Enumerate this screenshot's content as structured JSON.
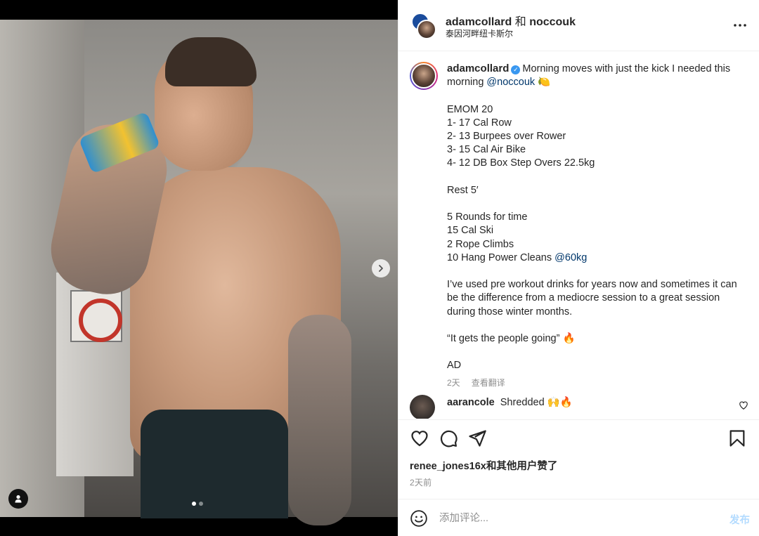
{
  "header": {
    "user1": "adamcollard",
    "and": "和",
    "user2": "noccouk",
    "location": "泰因河畔纽卡斯尔"
  },
  "caption": {
    "username": "adamcollard",
    "text_intro": "Morning moves with just the kick I needed this morning",
    "mention": "@noccouk",
    "emoji": "🍋",
    "lines": [
      "EMOM 20",
      "1- 17 Cal Row",
      "2- 13 Burpees over Rower",
      "3- 15 Cal Air Bike",
      "4- 12 DB Box Step Overs 22.5kg",
      "",
      "Rest 5′",
      "",
      "5 Rounds for time",
      "15 Cal Ski",
      "2 Rope Climbs",
      "10 Hang Power Cleans"
    ],
    "weight_mention": "@60kg",
    "paragraph": "I’ve used pre workout drinks for years now and sometimes it can be the difference from a mediocre session to a great session during those winter months.",
    "quote": "“It gets the people going” 🔥",
    "ad": "AD",
    "age": "2天",
    "translate": "查看翻译"
  },
  "comment": {
    "username": "aarancole",
    "text": "Shredded 🙌🔥"
  },
  "likes": {
    "text": "renee_jones16x和其他用户赞了"
  },
  "post_time": "2天前",
  "comment_box": {
    "placeholder": "添加评论...",
    "post_label": "发布"
  },
  "carousel": {
    "current": 1,
    "total": 2
  },
  "colors": {
    "accent": "#0095f6",
    "mention": "#00376b",
    "post_disabled": "#b3dbff",
    "verified": "#3897f0"
  }
}
